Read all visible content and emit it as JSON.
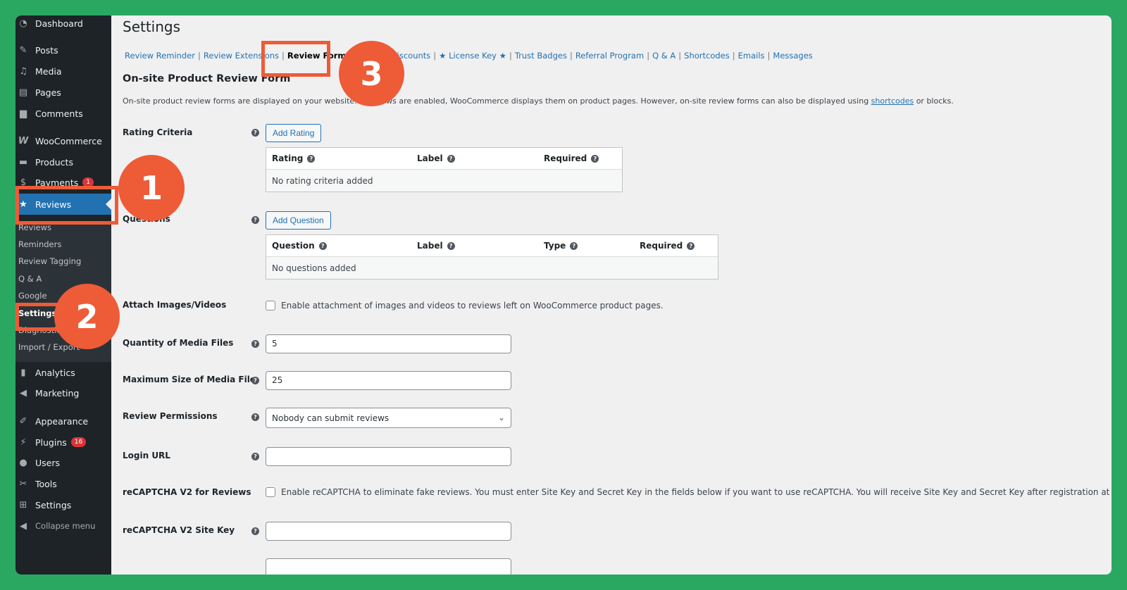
{
  "sidebar": {
    "items": [
      {
        "label": "Dashboard",
        "icon": "dashboard-icon"
      },
      {
        "label": "Posts",
        "icon": "pin-icon"
      },
      {
        "label": "Media",
        "icon": "media-icon"
      },
      {
        "label": "Pages",
        "icon": "pages-icon"
      },
      {
        "label": "Comments",
        "icon": "comment-icon"
      },
      {
        "label": "WooCommerce",
        "icon": "woo-icon"
      },
      {
        "label": "Products",
        "icon": "archive-icon"
      },
      {
        "label": "Payments",
        "icon": "dollar-icon",
        "badge": "1"
      },
      {
        "label": "Reviews",
        "icon": "star-icon"
      },
      {
        "label": "Analytics",
        "icon": "chart-icon"
      },
      {
        "label": "Marketing",
        "icon": "megaphone-icon"
      },
      {
        "label": "Appearance",
        "icon": "brush-icon"
      },
      {
        "label": "Plugins",
        "icon": "plug-icon",
        "badge": "16"
      },
      {
        "label": "Users",
        "icon": "user-icon"
      },
      {
        "label": "Tools",
        "icon": "wrench-icon"
      },
      {
        "label": "Settings",
        "icon": "settings-icon"
      },
      {
        "label": "Collapse menu",
        "icon": "collapse-icon"
      }
    ],
    "submenu": [
      "Reviews",
      "Reminders",
      "Review Tagging",
      "Q & A",
      "Google",
      "Settings",
      "Diagnostics",
      "Import / Export"
    ]
  },
  "page": {
    "title": "Settings",
    "tabs": [
      "Review Reminder",
      "Review Extensions",
      "Review Forms",
      "Review Discounts",
      "★ License Key ★",
      "Trust Badges",
      "Referral Program",
      "Q & A",
      "Shortcodes",
      "Emails",
      "Messages"
    ],
    "section_title": "On-site Product Review Form",
    "desc_before": "On-site product review forms are displayed on your website. If reviews are enabled, WooCommerce displays them on product pages. However, on-site review forms can also be displayed using ",
    "desc_link": "shortcodes",
    "desc_after": " or blocks."
  },
  "form": {
    "rating_label": "Rating Criteria",
    "add_rating": "Add Rating",
    "rating_headers": [
      "Rating",
      "Label",
      "Required"
    ],
    "rating_empty": "No rating criteria added",
    "questions_label": "Questions",
    "add_question": "Add Question",
    "question_headers": [
      "Question",
      "Label",
      "Type",
      "Required"
    ],
    "question_empty": "No questions added",
    "attach_label": "Attach Images/Videos",
    "attach_text": "Enable attachment of images and videos to reviews left on WooCommerce product pages.",
    "qty_label": "Quantity of Media Files",
    "qty_value": "5",
    "maxsize_label": "Maximum Size of Media File",
    "maxsize_value": "25",
    "perm_label": "Review Permissions",
    "perm_value": "Nobody can submit reviews",
    "login_label": "Login URL",
    "login_value": "",
    "recaptcha_label": "reCAPTCHA V2 for Reviews",
    "recaptcha_text": "Enable reCAPTCHA to eliminate fake reviews. You must enter Site Key and Secret Key in the fields below if you want to use reCAPTCHA. You will receive Site Key and Secret Key after registration at reCAPTCHA website.",
    "sitekey_label": "reCAPTCHA V2 Site Key",
    "sitekey_value": ""
  },
  "callouts": [
    "1",
    "2",
    "3"
  ],
  "colors": {
    "accent": "#ee5b37",
    "frame_bg": "#2aa862",
    "wp_blue": "#2271b1",
    "sidebar_bg": "#1d2327"
  }
}
